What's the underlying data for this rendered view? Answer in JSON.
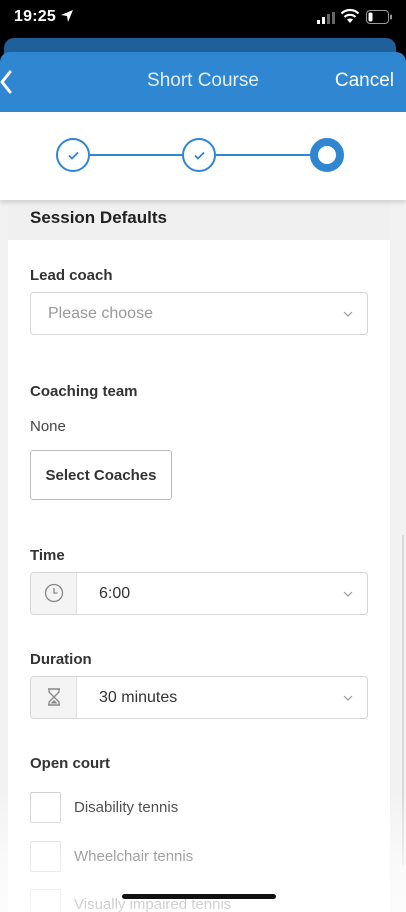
{
  "status_bar": {
    "time": "19:25"
  },
  "header": {
    "title": "Short Course",
    "cancel_label": "Cancel"
  },
  "stepper": {
    "steps": [
      {
        "state": "complete"
      },
      {
        "state": "complete"
      },
      {
        "state": "current"
      }
    ]
  },
  "section": {
    "title": "Session Defaults"
  },
  "lead_coach": {
    "label": "Lead coach",
    "placeholder": "Please choose"
  },
  "coaching_team": {
    "label": "Coaching team",
    "value": "None",
    "button_label": "Select Coaches"
  },
  "time": {
    "label": "Time",
    "value": "6:00",
    "icon": "clock-icon"
  },
  "duration": {
    "label": "Duration",
    "value": "30 minutes",
    "icon": "hourglass-icon"
  },
  "open_court": {
    "label": "Open court",
    "options": [
      {
        "label": "Disability tennis",
        "checked": false
      },
      {
        "label": "Wheelchair tennis",
        "checked": false
      },
      {
        "label": "Visually impaired tennis",
        "checked": false
      }
    ]
  },
  "colors": {
    "accent": "#2f86d1",
    "accent_dark": "#1f5f9a"
  }
}
